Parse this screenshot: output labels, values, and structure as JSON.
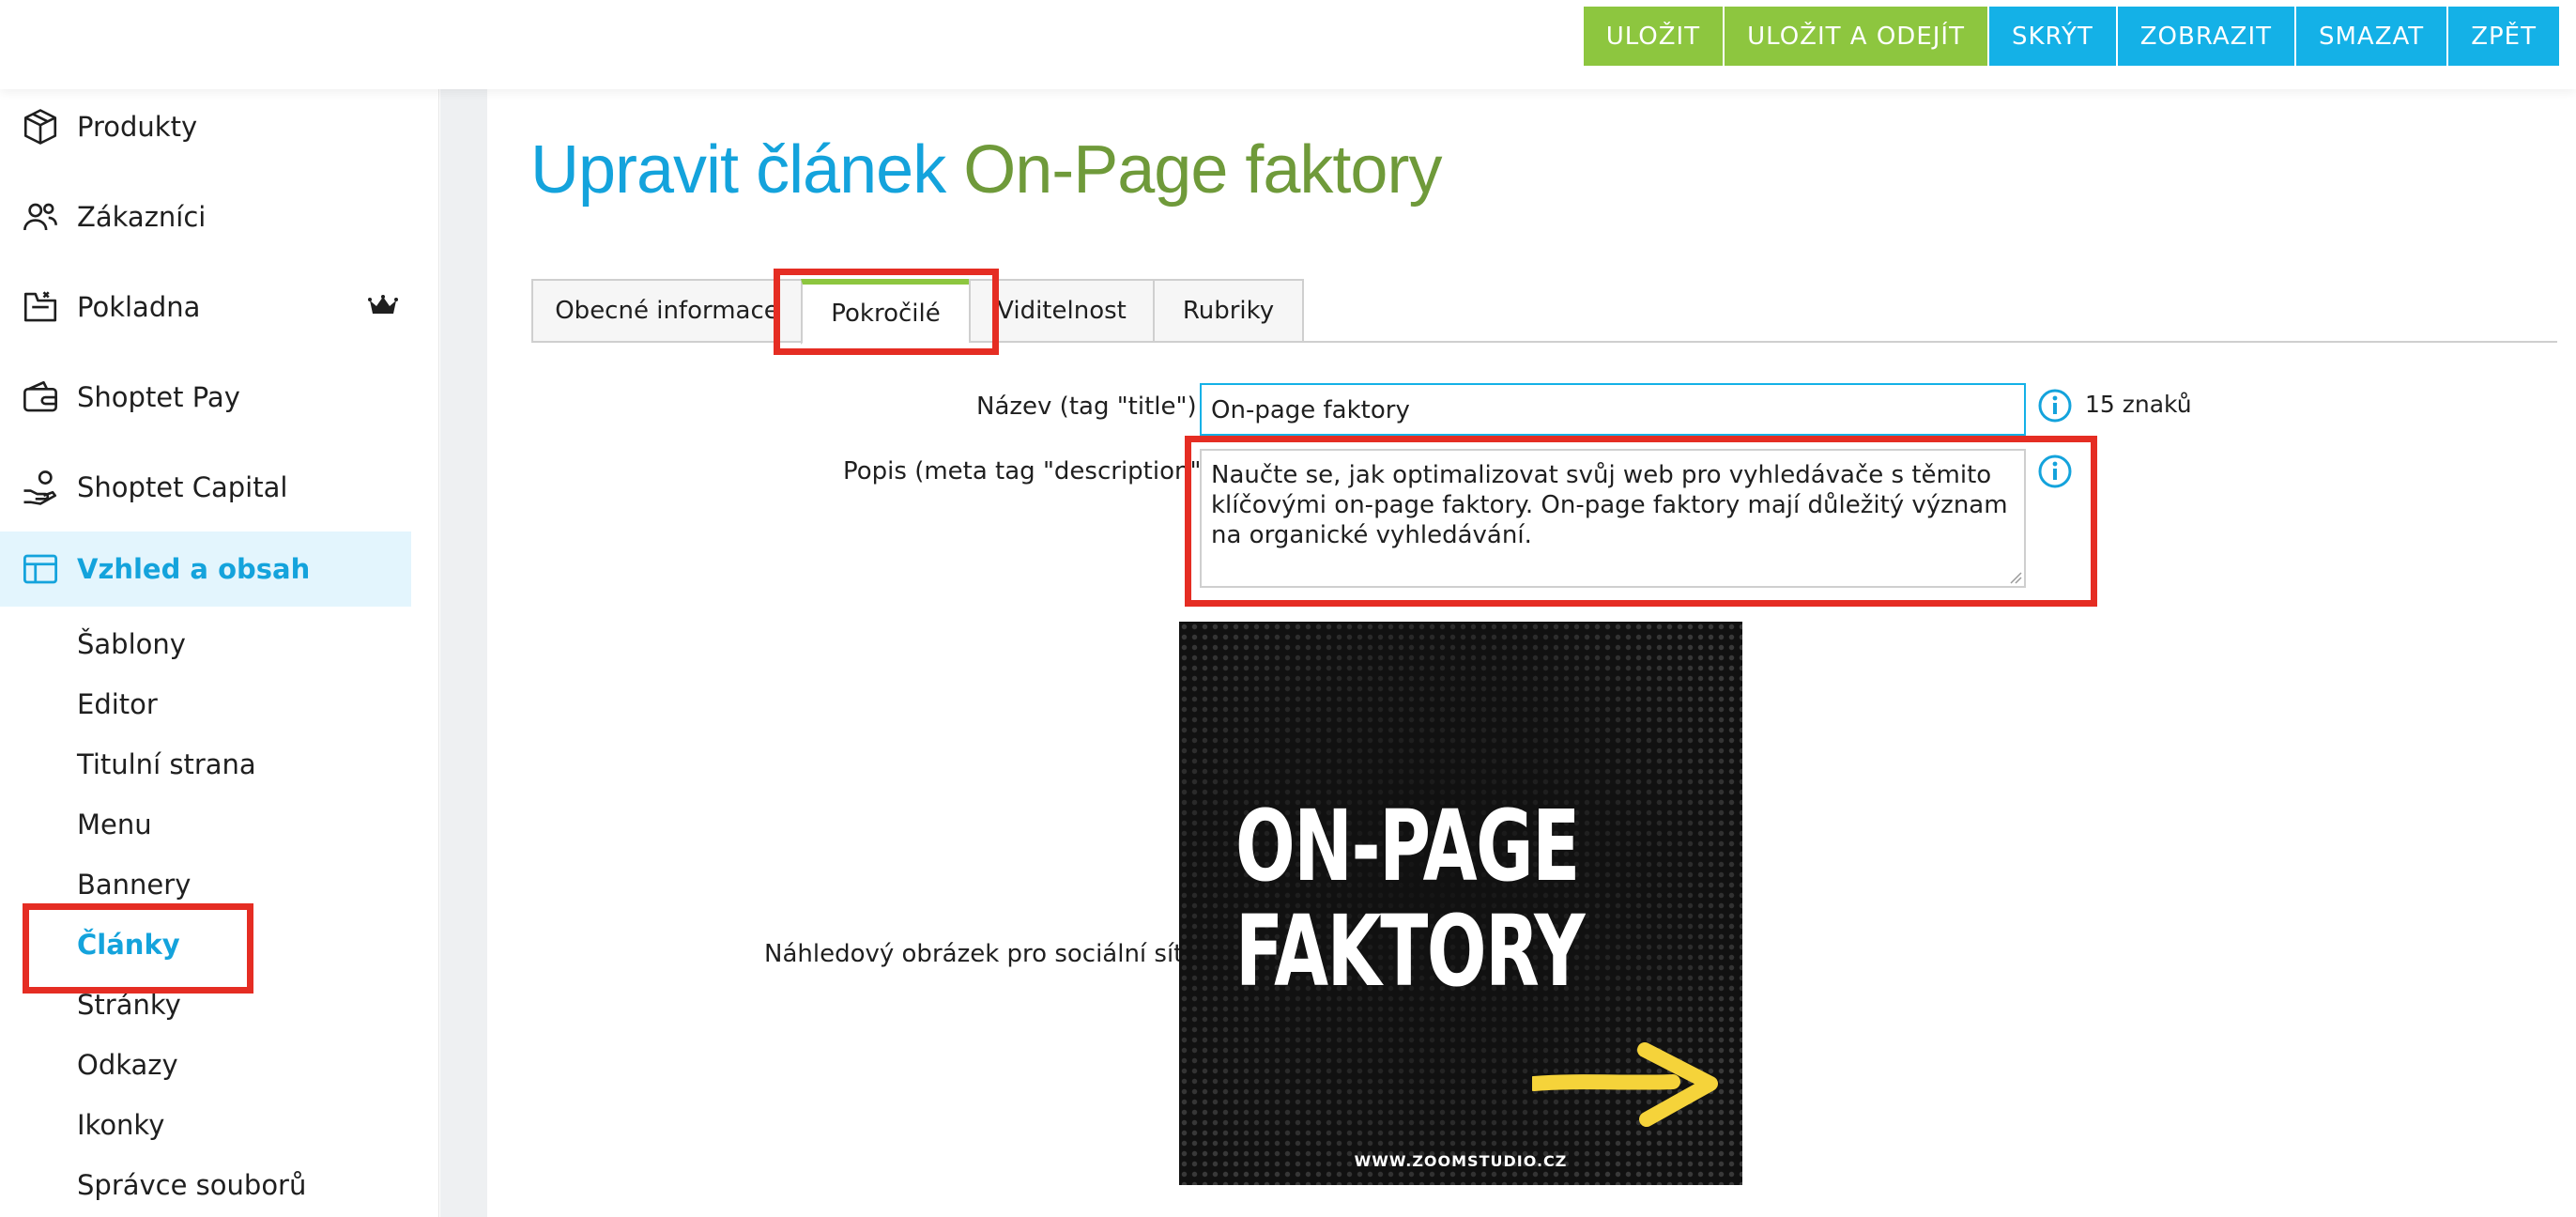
{
  "toolbar": {
    "save": "ULOŽIT",
    "save_and_leave": "ULOŽIT A ODEJÍT",
    "hide": "SKRÝT",
    "show": "ZOBRAZIT",
    "delete": "SMAZAT",
    "back": "ZPĚT",
    "colors": {
      "green": "#8dc63f",
      "blue": "#14b1e7"
    }
  },
  "sidebar": {
    "items": [
      {
        "label": "Produkty",
        "icon": "box-icon"
      },
      {
        "label": "Zákazníci",
        "icon": "users-icon"
      },
      {
        "label": "Pokladna",
        "icon": "cash-register-icon",
        "badge_icon": "crown-icon"
      },
      {
        "label": "Shoptet Pay",
        "icon": "wallet-icon"
      },
      {
        "label": "Shoptet Capital",
        "icon": "money-hand-icon"
      },
      {
        "label": "Vzhled a obsah",
        "icon": "layout-icon",
        "active": true
      }
    ],
    "subitems": [
      {
        "label": "Šablony"
      },
      {
        "label": "Editor"
      },
      {
        "label": "Titulní strana"
      },
      {
        "label": "Menu"
      },
      {
        "label": "Bannery"
      },
      {
        "label": "Články",
        "active": true
      },
      {
        "label": "Stránky"
      },
      {
        "label": "Odkazy"
      },
      {
        "label": "Ikonky"
      },
      {
        "label": "Správce souborů"
      }
    ]
  },
  "page": {
    "title_prefix": "Upravit článek",
    "title_name": "On-Page faktory"
  },
  "tabs": [
    {
      "label": "Obecné informace"
    },
    {
      "label": "Pokročilé",
      "active": true
    },
    {
      "label": "Viditelnost"
    },
    {
      "label": "Rubriky"
    }
  ],
  "form": {
    "title_label": "Název (tag \"title\")",
    "title_value": "On-page faktory",
    "title_count": "15 znaků",
    "description_label": "Popis (meta tag \"description\")",
    "description_value": "Naučte se, jak optimalizovat svůj web pro vyhledávače s těmito klíčovými on-page faktory. On-page faktory mají důležitý význam na organické vyhledávání.",
    "image_label": "Náhledový obrázek pro sociální sítě"
  },
  "preview_image": {
    "line1": "ON-PAGE",
    "line2": "FAKTORY",
    "url": "WWW.ZOOMSTUDIO.CZ",
    "arrow_color": "#f5d33a"
  }
}
